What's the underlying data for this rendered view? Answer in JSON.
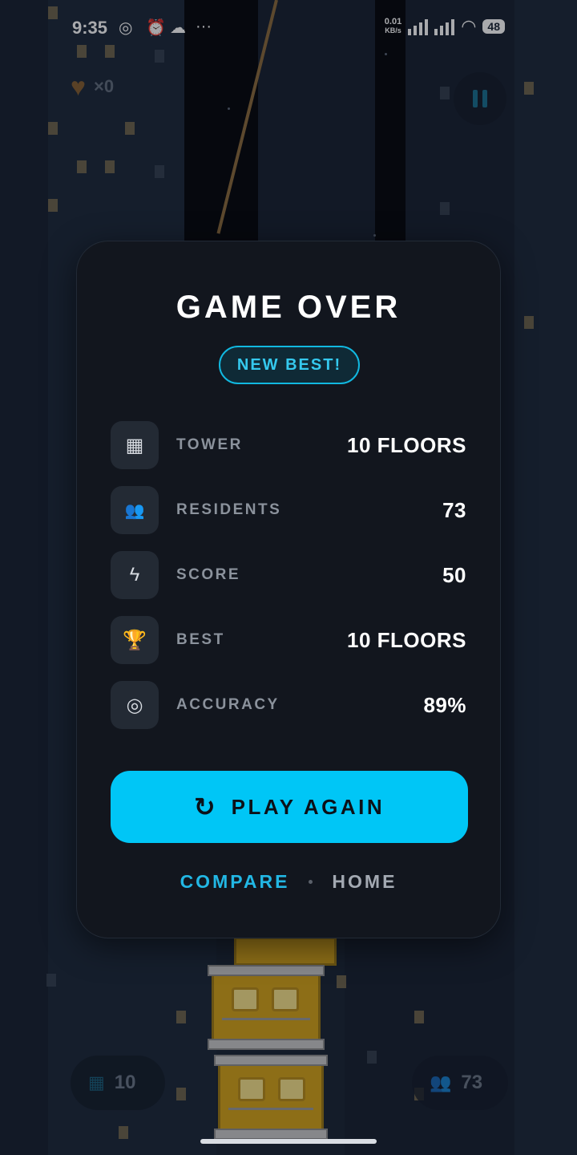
{
  "status_bar": {
    "time": "9:35",
    "net_speed_value": "0.01",
    "net_speed_unit": "KB/s",
    "battery": "48"
  },
  "hud": {
    "hearts_count": "×0",
    "floors_count": "10",
    "residents_count": "73"
  },
  "game_over": {
    "title": "GAME OVER",
    "badge": "NEW BEST!",
    "stats": [
      {
        "label": "TOWER",
        "value": "10 FLOORS",
        "icon": "building-icon"
      },
      {
        "label": "RESIDENTS",
        "value": "73",
        "icon": "people-icon"
      },
      {
        "label": "SCORE",
        "value": "50",
        "icon": "lightning-icon"
      },
      {
        "label": "BEST",
        "value": "10 FLOORS",
        "icon": "trophy-icon"
      },
      {
        "label": "ACCURACY",
        "value": "89%",
        "icon": "target-icon"
      }
    ],
    "play_again_label": "PLAY AGAIN",
    "compare_label": "COMPARE",
    "home_label": "HOME"
  },
  "colors": {
    "accent": "#00c6f6",
    "badge_text": "#35c9ee",
    "modal_bg": "#12161e"
  }
}
